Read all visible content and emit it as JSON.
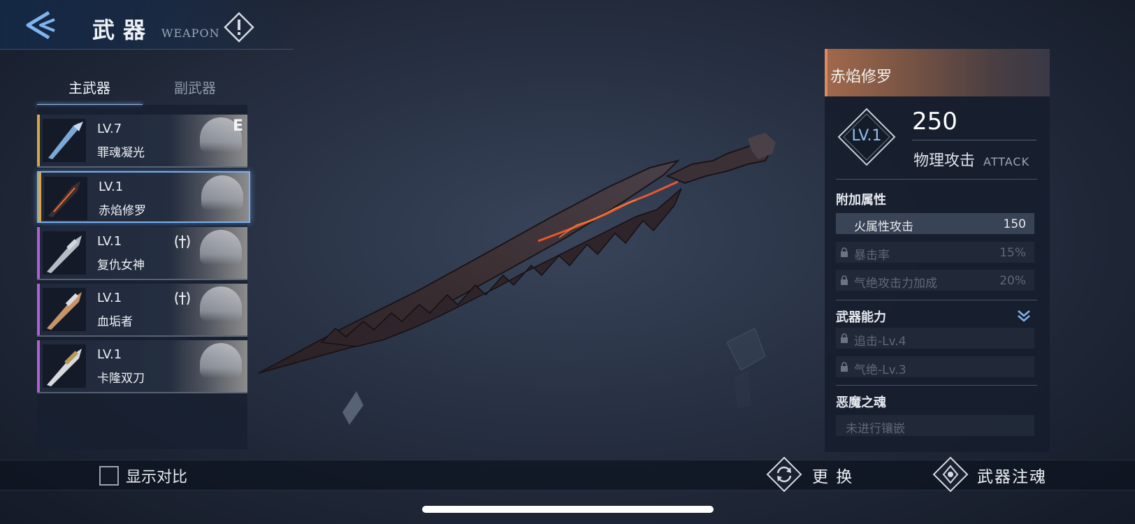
{
  "header": {
    "title": "武器",
    "title_en": "WEAPON"
  },
  "tabs": [
    {
      "label": "主武器",
      "active": true
    },
    {
      "label": "副武器",
      "active": false
    }
  ],
  "weapons": [
    {
      "level": "LV.7",
      "name": "罪魂凝光",
      "rarity_color": "#d9a545",
      "equipped_mark": "E",
      "selected": false,
      "has_skill_icon": false
    },
    {
      "level": "LV.1",
      "name": "赤焰修罗",
      "rarity_color": "#d9a545",
      "equipped_mark": "",
      "selected": true,
      "has_skill_icon": false
    },
    {
      "level": "LV.1",
      "name": "复仇女神",
      "rarity_color": "#b25fd6",
      "equipped_mark": "",
      "selected": false,
      "has_skill_icon": true
    },
    {
      "level": "LV.1",
      "name": "血垢者",
      "rarity_color": "#b25fd6",
      "equipped_mark": "",
      "selected": false,
      "has_skill_icon": true
    },
    {
      "level": "LV.1",
      "name": "卡隆双刀",
      "rarity_color": "#b25fd6",
      "equipped_mark": "",
      "selected": false,
      "has_skill_icon": false
    }
  ],
  "detail": {
    "name": "赤焰修罗",
    "level": "LV.1",
    "attack_value": "250",
    "attack_label": "物理攻击",
    "attack_label_en": "ATTACK",
    "extra_attributes_title": "附加属性",
    "extra_attributes": [
      {
        "name": "火属性攻击",
        "value": "150",
        "locked": false
      },
      {
        "name": "暴击率",
        "value": "15%",
        "locked": true
      },
      {
        "name": "气绝攻击力加成",
        "value": "20%",
        "locked": true
      }
    ],
    "abilities_title": "武器能力",
    "abilities": [
      {
        "name": "追击-Lv.4",
        "locked": true
      },
      {
        "name": "气绝-Lv.3",
        "locked": true
      }
    ],
    "soul_title": "恶魔之魂",
    "soul_empty_text": "未进行镶嵌"
  },
  "bottom": {
    "compare_label": "显示对比",
    "compare_checked": false,
    "replace_label": "更 换",
    "infuse_label": "武器注魂"
  },
  "icons": {
    "back": "back-arrow-icon",
    "info": "info-icon",
    "lock": "lock-icon",
    "expand": "double-chevron-down-icon",
    "replace": "swap-icon",
    "infuse": "infuse-icon"
  },
  "colors": {
    "accent_blue": "#7ab0ec",
    "header_orange": "#a2694c",
    "legendary": "#d9a545",
    "epic": "#b25fd6"
  }
}
